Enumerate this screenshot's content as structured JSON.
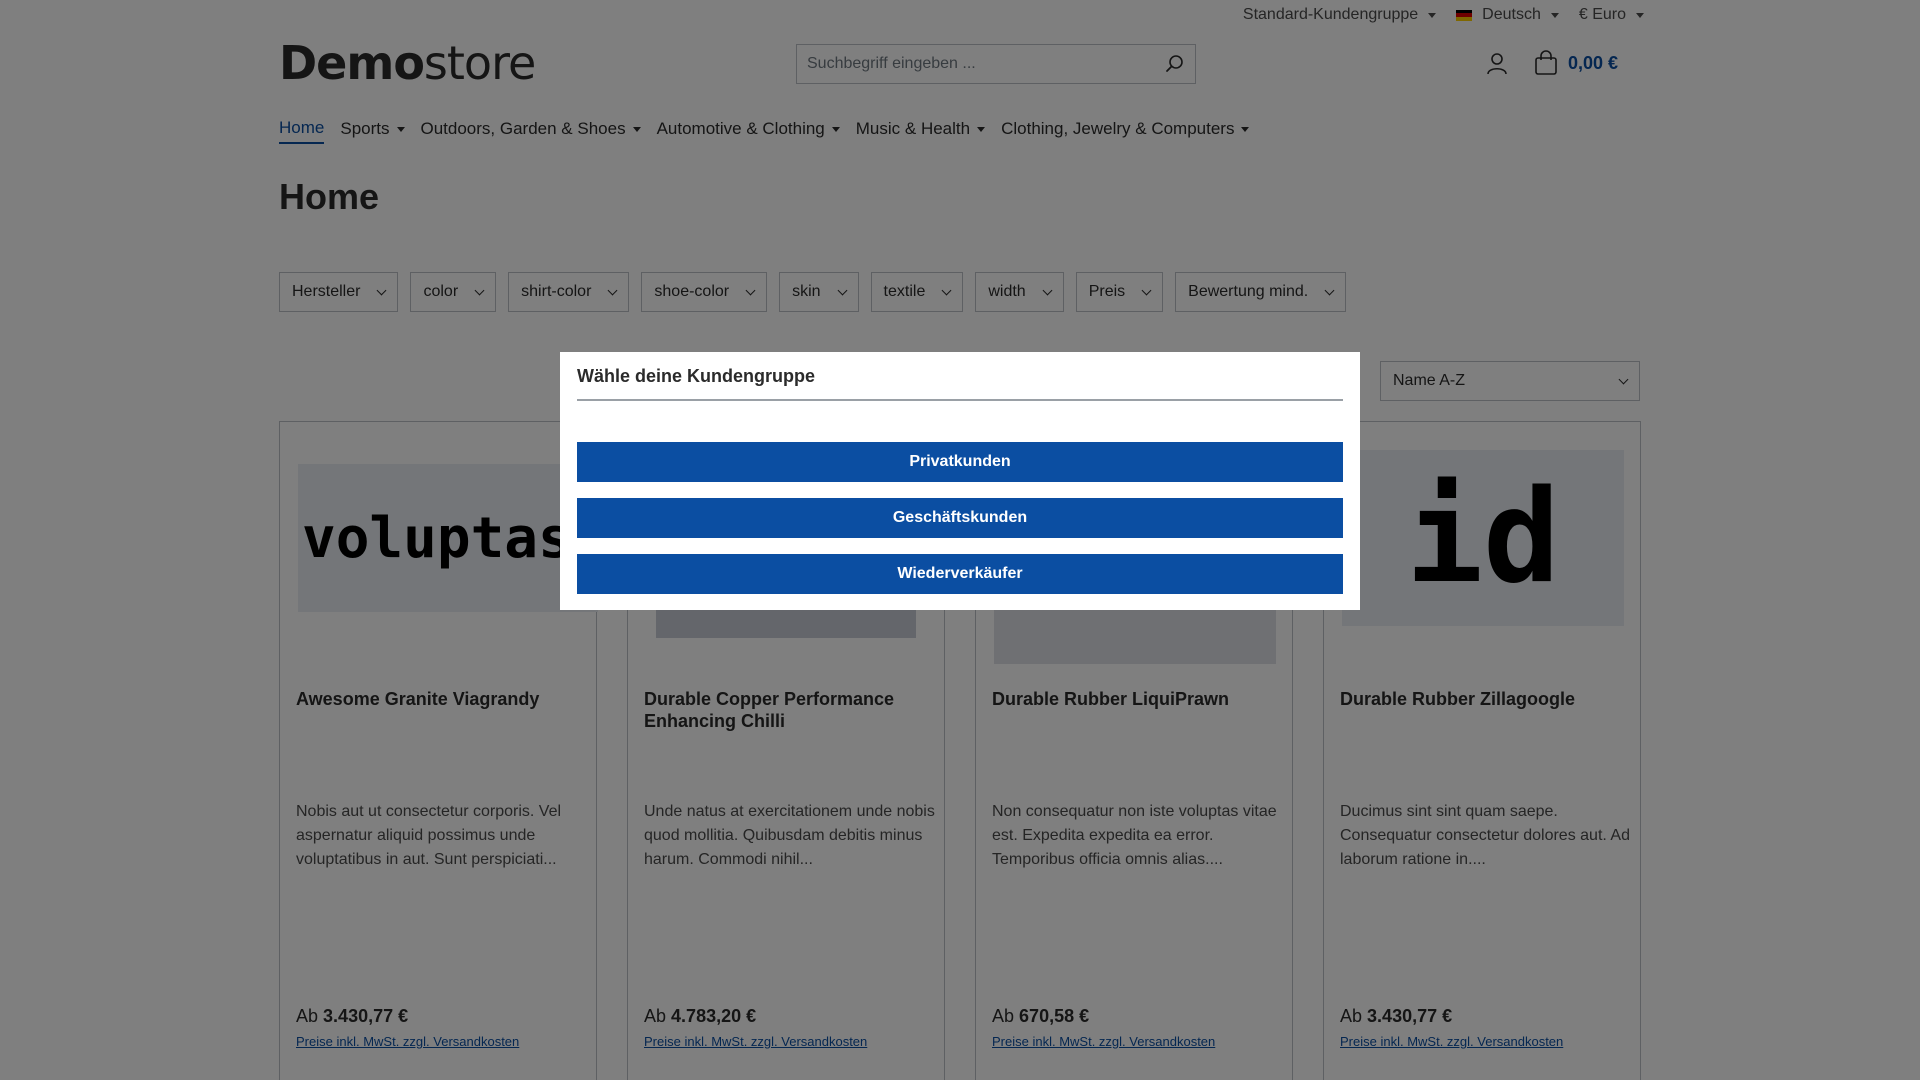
{
  "topbar": {
    "customer_group": "Standard-Kundengruppe",
    "language": "Deutsch",
    "currency": "€ Euro"
  },
  "header": {
    "logo_bold": "Demo",
    "logo_light": "store",
    "search_placeholder": "Suchbegriff eingeben ...",
    "cart_amount": "0,00 €"
  },
  "nav": {
    "items": [
      {
        "label": "Home",
        "active": true
      },
      {
        "label": "Sports"
      },
      {
        "label": "Outdoors, Garden & Shoes"
      },
      {
        "label": "Automotive & Clothing"
      },
      {
        "label": "Music & Health"
      },
      {
        "label": "Clothing, Jewelry & Computers"
      }
    ]
  },
  "page_title": "Home",
  "filters": [
    "Hersteller",
    "color",
    "shirt-color",
    "shoe-color",
    "skin",
    "textile",
    "width",
    "Preis",
    "Bewertung mind."
  ],
  "sort": {
    "selected": "Name A-Z"
  },
  "products": [
    {
      "image_text": "voluptas",
      "name": "Awesome Granite Viagrandy",
      "description": "Nobis aut ut consectetur corporis. Vel aspernatur aliquid possimus unde voluptatibus in aut. Sunt perspiciati...",
      "price_prefix": "Ab",
      "price": "3.430,77 €",
      "note": "Preise inkl. MwSt. zzgl. Versandkosten"
    },
    {
      "image_text": "",
      "name": "Durable Copper Performance Enhancing Chilli",
      "description": "Unde natus at exercitationem unde nobis quod mollitia. Quibusdam debitis minus harum. Commodi nihil...",
      "price_prefix": "Ab",
      "price": "4.783,20 €",
      "note": "Preise inkl. MwSt. zzgl. Versandkosten"
    },
    {
      "image_text": "",
      "name": "Durable Rubber LiquiPrawn",
      "description": "Non consequatur non iste voluptas vitae est. Expedita expedita ea error. Temporibus officia omnis alias....",
      "price_prefix": "Ab",
      "price": "670,58 €",
      "note": "Preise inkl. MwSt. zzgl. Versandkosten"
    },
    {
      "image_text": "id",
      "name": "Durable Rubber Zillagoogle",
      "description": "Ducimus sint sint quam saepe. Consequatur consectetur dolores aut. Ad laborum ratione in....",
      "price_prefix": "Ab",
      "price": "3.430,77 €",
      "note": "Preise inkl. MwSt. zzgl. Versandkosten"
    }
  ],
  "modal": {
    "title": "Wähle deine Kundengruppe",
    "buttons": [
      "Privatkunden",
      "Geschäftskunden",
      "Wiederverkäufer"
    ]
  },
  "colors": {
    "accent": "#0b4ea2",
    "overlay": "rgba(0,0,0,0.5)"
  }
}
